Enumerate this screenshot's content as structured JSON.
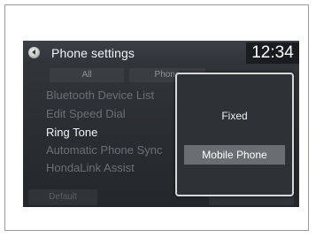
{
  "header": {
    "title": "Phone settings",
    "clock": "12:34"
  },
  "tabs": [
    {
      "label": "All"
    },
    {
      "label": "Phone"
    }
  ],
  "menu": {
    "items": [
      {
        "label": "Bluetooth Device List",
        "active": false
      },
      {
        "label": "Edit Speed Dial",
        "active": false
      },
      {
        "label": "Ring Tone",
        "active": true
      },
      {
        "label": "Automatic Phone Sync",
        "active": false
      },
      {
        "label": "HondaLink Assist",
        "active": false
      }
    ]
  },
  "footer": {
    "left_label": "Default",
    "right_label": ""
  },
  "popup": {
    "options": [
      {
        "label": "Fixed",
        "selected": false
      },
      {
        "label": "Mobile Phone",
        "selected": true
      }
    ]
  }
}
